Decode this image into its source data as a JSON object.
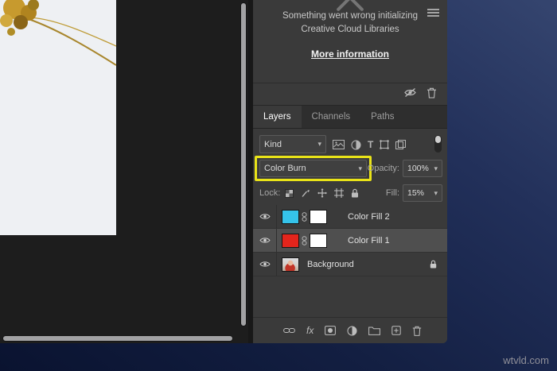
{
  "icons": {
    "chevron_down": "▾"
  },
  "libraries": {
    "error_line1": "Something went wrong initializing",
    "error_line2": "Creative Cloud Libraries",
    "more_info": "More information"
  },
  "layers_panel": {
    "tabs": {
      "layers": "Layers",
      "channels": "Channels",
      "paths": "Paths"
    },
    "filter_kind": "Kind",
    "blend_mode": "Color Burn",
    "opacity_label": "Opacity:",
    "opacity_value": "100%",
    "lock_label": "Lock:",
    "fill_label": "Fill:",
    "fill_value": "15%",
    "fx_label": "fx",
    "highlight_color": "#e9e318",
    "layers": [
      {
        "name": "Color Fill 2",
        "swatch": "#35c3ea",
        "selected": false
      },
      {
        "name": "Color Fill 1",
        "swatch": "#e3251c",
        "selected": true
      },
      {
        "name": "Background",
        "locked": true
      }
    ]
  },
  "wallpaper": {
    "watermark": "wtvld.com"
  }
}
